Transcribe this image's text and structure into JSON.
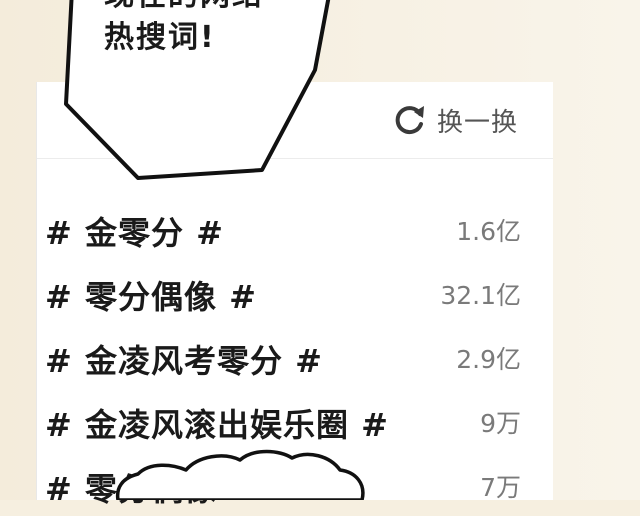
{
  "bubble": {
    "partial_line": "现在的网络",
    "line": "热搜词!"
  },
  "header": {
    "refresh_icon": "refresh-icon",
    "refresh_label": "换一换"
  },
  "topics": [
    {
      "name": "# 金零分 #",
      "count": "1.6亿"
    },
    {
      "name": "# 零分偶像 #",
      "count": "32.1亿"
    },
    {
      "name": "# 金凌风考零分 #",
      "count": "2.9亿"
    },
    {
      "name": "# 金凌风滚出娱乐圈 #",
      "count": "9万"
    },
    {
      "name": "# 零分偶像 #",
      "count": "7万"
    }
  ],
  "colors": {
    "ink": "#1a1a1a",
    "muted": "#7a7a7a",
    "panel": "#ffffff",
    "paper": "#f6efe0"
  }
}
